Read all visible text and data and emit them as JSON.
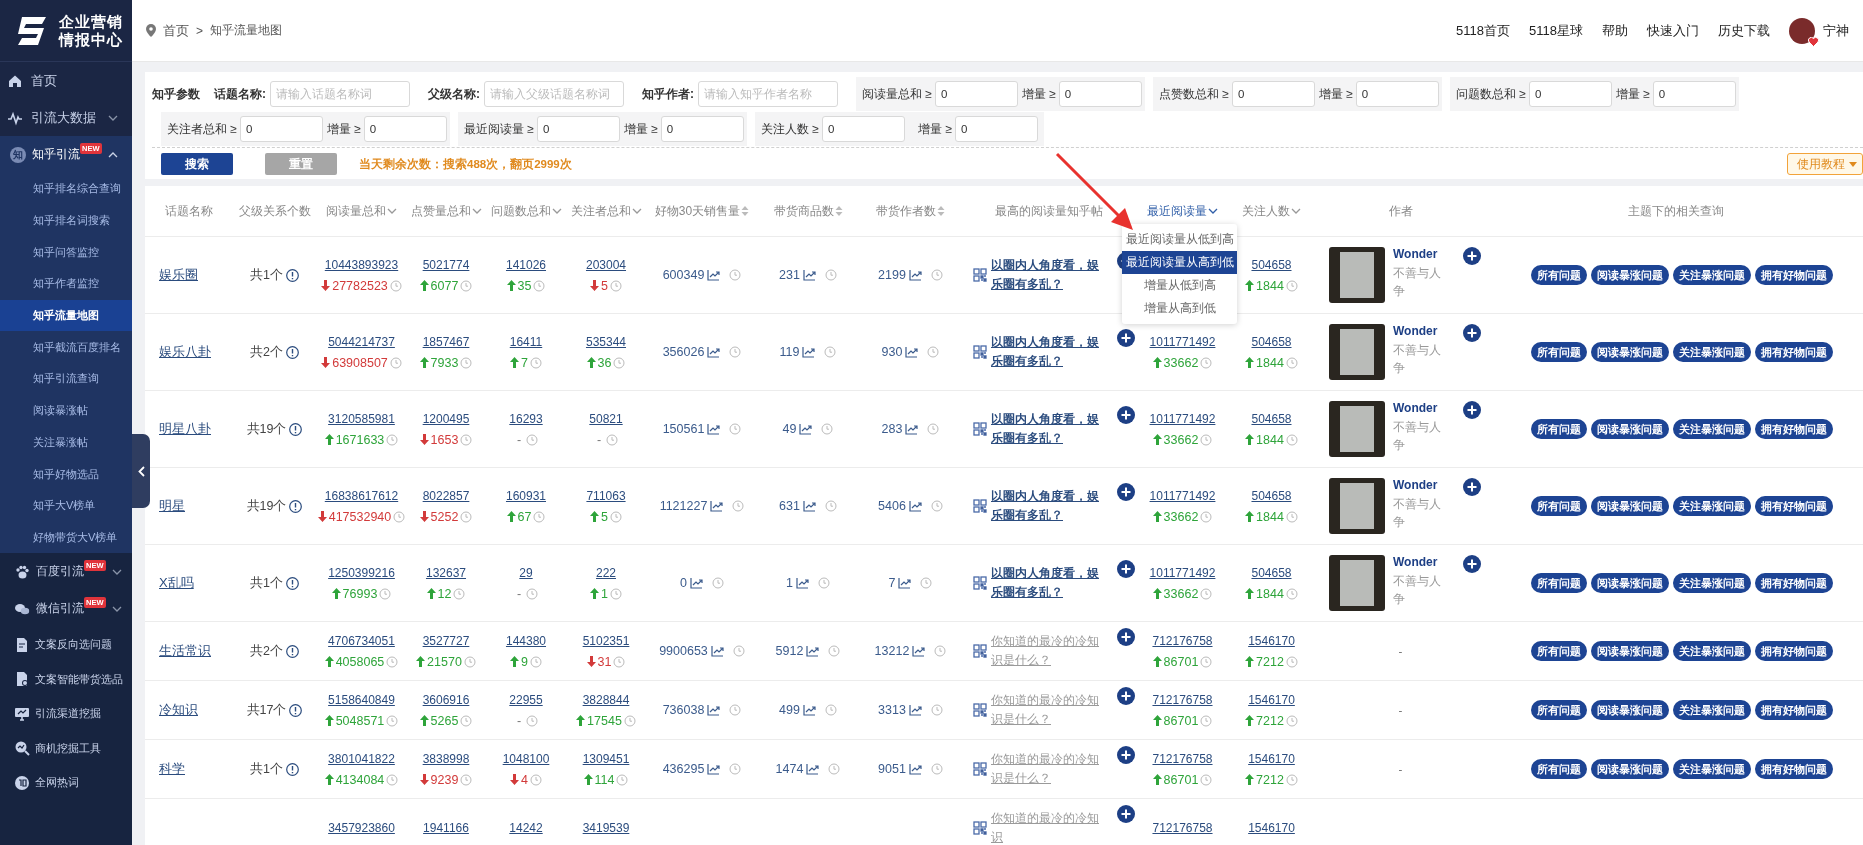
{
  "sidebar": {
    "logo_lines": [
      "企业营销",
      "情报中心"
    ],
    "items": [
      {
        "label": "首页",
        "kind": "nav"
      },
      {
        "label": "引流大数据",
        "kind": "group",
        "expanded": false
      },
      {
        "label": "知乎引流",
        "kind": "group",
        "icon_text": "知",
        "badge": "NEW",
        "expanded": true,
        "children": [
          {
            "label": "知乎排名综合查询",
            "selected": false
          },
          {
            "label": "知乎排名词搜索",
            "selected": false
          },
          {
            "label": "知乎问答监控",
            "selected": false
          },
          {
            "label": "知乎作者监控",
            "selected": false
          },
          {
            "label": "知乎流量地图",
            "selected": true
          },
          {
            "label": "知乎截流百度排名",
            "selected": false
          },
          {
            "label": "知乎引流查询",
            "selected": false
          },
          {
            "label": "阅读暴涨帖",
            "selected": false
          },
          {
            "label": "关注暴涨帖",
            "selected": false
          },
          {
            "label": "知乎好物选品",
            "selected": false
          },
          {
            "label": "知乎大V榜单",
            "selected": false
          },
          {
            "label": "好物带货大V榜单",
            "selected": false
          }
        ]
      },
      {
        "label": "百度引流",
        "kind": "group",
        "badge": "NEW",
        "expanded": false
      },
      {
        "label": "微信引流",
        "kind": "group",
        "badge": "NEW",
        "expanded": false
      },
      {
        "label": "文案反向选问题",
        "kind": "tool"
      },
      {
        "label": "文案智能带货选品",
        "kind": "tool"
      },
      {
        "label": "引流渠道挖掘",
        "kind": "tool"
      },
      {
        "label": "商机挖掘工具",
        "kind": "tool"
      },
      {
        "label": "全网热词",
        "kind": "tool"
      }
    ]
  },
  "header": {
    "breadcrumb": [
      "首页",
      "知乎流量地图"
    ],
    "breadcrumb_separator": ">",
    "nav_links": [
      "5118首页",
      "5118星球",
      "帮助",
      "快速入门",
      "历史下载"
    ],
    "user": {
      "name": "宁神"
    }
  },
  "filters": {
    "rows": [
      {
        "label": "知乎参数",
        "text_fields": [
          {
            "label": "话题名称:",
            "placeholder": "请输入话题名称词"
          },
          {
            "label": "父级名称:",
            "placeholder": "请输入父级话题名称词"
          },
          {
            "label": "知乎作者:",
            "placeholder": "请输入知乎作者名称"
          }
        ],
        "range_groups": [
          {
            "fields": [
              {
                "label": "阅读量总和 ≥",
                "value": "0"
              },
              {
                "label": "增量 ≥",
                "value": "0"
              }
            ]
          },
          {
            "fields": [
              {
                "label": "点赞数总和 ≥",
                "value": "0"
              },
              {
                "label": "增量 ≥",
                "value": "0"
              }
            ]
          },
          {
            "fields": [
              {
                "label": "问题数总和 ≥",
                "value": "0"
              },
              {
                "label": "增量 ≥",
                "value": "0"
              }
            ]
          }
        ]
      },
      {
        "range_groups": [
          {
            "fields": [
              {
                "label": "关注者总和 ≥",
                "value": "0"
              },
              {
                "label": "增量 ≥",
                "value": "0"
              }
            ]
          },
          {
            "fields": [
              {
                "label": "最近阅读量 ≥",
                "value": "0"
              },
              {
                "label": "增量 ≥",
                "value": "0"
              }
            ]
          },
          {
            "fields": [
              {
                "label": "关注人数 ≥",
                "value": "0"
              },
              {
                "label": "增量 ≥",
                "value": "0"
              }
            ]
          }
        ]
      }
    ],
    "search_button": "搜索",
    "reset_button": "重置",
    "quota_text": "当天剩余次数：搜索488次，翻页2999次",
    "tutorial_button": "使用教程"
  },
  "table": {
    "columns": [
      {
        "label": "话题名称",
        "kind": "plain",
        "selected": false
      },
      {
        "label": "父级关系个数",
        "kind": "plain",
        "selected": false
      },
      {
        "label": "阅读量总和",
        "kind": "desc",
        "selected": false
      },
      {
        "label": "点赞量总和",
        "kind": "desc",
        "selected": false
      },
      {
        "label": "问题数总和",
        "kind": "desc",
        "selected": false
      },
      {
        "label": "关注者总和",
        "kind": "desc",
        "selected": false
      },
      {
        "label": "好物30天销售量",
        "kind": "both",
        "selected": false
      },
      {
        "label": "带货商品数",
        "kind": "both",
        "selected": false
      },
      {
        "label": "带货作者数",
        "kind": "both",
        "selected": false
      },
      {
        "label": "最高的阅读量知乎帖",
        "kind": "plain",
        "selected": false
      },
      {
        "label": "最近阅读量",
        "kind": "desc",
        "selected": true,
        "menu": [
          {
            "label": "最近阅读量从低到高",
            "selected": false
          },
          {
            "label": "最近阅读量从高到低",
            "selected": true
          },
          {
            "label": "增量从低到高",
            "selected": false
          },
          {
            "label": "增量从高到低",
            "selected": false
          }
        ]
      },
      {
        "label": "关注人数",
        "kind": "desc",
        "selected": false
      },
      {
        "label": "作者",
        "kind": "plain",
        "selected": false
      },
      {
        "label": "主题下的相关查询",
        "kind": "plain",
        "selected": false
      }
    ],
    "rows": [
      {
        "topic": "娱乐圈",
        "parent_count": "共1个",
        "read": {
          "value": "10443893923",
          "delta": {
            "kind": "down",
            "value": "27782523"
          }
        },
        "likes": {
          "value": "5021774",
          "delta": {
            "kind": "up",
            "value": "6077"
          }
        },
        "questions": {
          "value": "141026",
          "delta": {
            "kind": "up",
            "value": "35"
          }
        },
        "followers": {
          "value": "203004",
          "delta": {
            "kind": "down",
            "value": "5"
          }
        },
        "sales": "600349",
        "goods": "231",
        "sellers": "2199",
        "post": {
          "title": "以圈内人角度看，娱乐圈有多乱？",
          "visited": false
        },
        "fans": {
          "value": "504658",
          "delta": {
            "kind": "up",
            "value": "1844"
          }
        },
        "author": {
          "kind": "profile",
          "name": "Wonder",
          "bio": "不善与人争"
        },
        "actions": [
          "所有问题",
          "阅读暴涨问题",
          "关注暴涨问题",
          "拥有好物问题"
        ]
      },
      {
        "topic": "娱乐八卦",
        "parent_count": "共2个",
        "read": {
          "value": "5044214737",
          "delta": {
            "kind": "down",
            "value": "63908507"
          }
        },
        "likes": {
          "value": "1857467",
          "delta": {
            "kind": "up",
            "value": "7933"
          }
        },
        "questions": {
          "value": "16411",
          "delta": {
            "kind": "up",
            "value": "7"
          }
        },
        "followers": {
          "value": "535344",
          "delta": {
            "kind": "up",
            "value": "36"
          }
        },
        "sales": "356026",
        "goods": "119",
        "sellers": "930",
        "post": {
          "title": "以圈内人角度看，娱乐圈有多乱？",
          "visited": false
        },
        "recent": {
          "value": "1011771492",
          "delta": {
            "kind": "up",
            "value": "33662"
          }
        },
        "fans": {
          "value": "504658",
          "delta": {
            "kind": "up",
            "value": "1844"
          }
        },
        "author": {
          "kind": "profile",
          "name": "Wonder",
          "bio": "不善与人争"
        },
        "actions": [
          "所有问题",
          "阅读暴涨问题",
          "关注暴涨问题",
          "拥有好物问题"
        ]
      },
      {
        "topic": "明星八卦",
        "parent_count": "共19个",
        "read": {
          "value": "3120585981",
          "delta": {
            "kind": "up",
            "value": "1671633"
          }
        },
        "likes": {
          "value": "1200495",
          "delta": {
            "kind": "down",
            "value": "1653"
          }
        },
        "questions": {
          "value": "16293",
          "delta": {
            "kind": "none",
            "value": "-"
          }
        },
        "followers": {
          "value": "50821",
          "delta": {
            "kind": "none",
            "value": "-"
          }
        },
        "sales": "150561",
        "goods": "49",
        "sellers": "283",
        "post": {
          "title": "以圈内人角度看，娱乐圈有多乱？",
          "visited": false
        },
        "recent": {
          "value": "1011771492",
          "delta": {
            "kind": "up",
            "value": "33662"
          }
        },
        "fans": {
          "value": "504658",
          "delta": {
            "kind": "up",
            "value": "1844"
          }
        },
        "author": {
          "kind": "profile",
          "name": "Wonder",
          "bio": "不善与人争"
        },
        "actions": [
          "所有问题",
          "阅读暴涨问题",
          "关注暴涨问题",
          "拥有好物问题"
        ]
      },
      {
        "topic": "明星",
        "parent_count": "共19个",
        "read": {
          "value": "16838617612",
          "delta": {
            "kind": "down",
            "value": "417532940"
          }
        },
        "likes": {
          "value": "8022857",
          "delta": {
            "kind": "down",
            "value": "5252"
          }
        },
        "questions": {
          "value": "160931",
          "delta": {
            "kind": "up",
            "value": "67"
          }
        },
        "followers": {
          "value": "711063",
          "delta": {
            "kind": "up",
            "value": "5"
          }
        },
        "sales": "1121227",
        "goods": "631",
        "sellers": "5406",
        "post": {
          "title": "以圈内人角度看，娱乐圈有多乱？",
          "visited": false
        },
        "recent": {
          "value": "1011771492",
          "delta": {
            "kind": "up",
            "value": "33662"
          }
        },
        "fans": {
          "value": "504658",
          "delta": {
            "kind": "up",
            "value": "1844"
          }
        },
        "author": {
          "kind": "profile",
          "name": "Wonder",
          "bio": "不善与人争"
        },
        "actions": [
          "所有问题",
          "阅读暴涨问题",
          "关注暴涨问题",
          "拥有好物问题"
        ]
      },
      {
        "topic": "X乱吗",
        "parent_count": "共1个",
        "read": {
          "value": "1250399216",
          "delta": {
            "kind": "up",
            "value": "76993"
          }
        },
        "likes": {
          "value": "132637",
          "delta": {
            "kind": "up",
            "value": "12"
          }
        },
        "questions": {
          "value": "29",
          "delta": {
            "kind": "none",
            "value": "-"
          }
        },
        "followers": {
          "value": "222",
          "delta": {
            "kind": "up",
            "value": "1"
          }
        },
        "sales": "0",
        "goods": "1",
        "sellers": "7",
        "post": {
          "title": "以圈内人角度看，娱乐圈有多乱？",
          "visited": false
        },
        "recent": {
          "value": "1011771492",
          "delta": {
            "kind": "up",
            "value": "33662"
          }
        },
        "fans": {
          "value": "504658",
          "delta": {
            "kind": "up",
            "value": "1844"
          }
        },
        "author": {
          "kind": "profile",
          "name": "Wonder",
          "bio": "不善与人争"
        },
        "actions": [
          "所有问题",
          "阅读暴涨问题",
          "关注暴涨问题",
          "拥有好物问题"
        ]
      },
      {
        "topic": "生活常识",
        "parent_count": "共2个",
        "read": {
          "value": "4706734051",
          "delta": {
            "kind": "up",
            "value": "4058065"
          }
        },
        "likes": {
          "value": "3527727",
          "delta": {
            "kind": "up",
            "value": "21570"
          }
        },
        "questions": {
          "value": "144380",
          "delta": {
            "kind": "up",
            "value": "9"
          }
        },
        "followers": {
          "value": "5102351",
          "delta": {
            "kind": "down",
            "value": "31"
          }
        },
        "sales": "9900653",
        "goods": "5912",
        "sellers": "13212",
        "post": {
          "title": "你知道的最冷的冷知识是什么？",
          "visited": true
        },
        "recent": {
          "value": "712176758",
          "delta": {
            "kind": "up",
            "value": "86701"
          }
        },
        "fans": {
          "value": "1546170",
          "delta": {
            "kind": "up",
            "value": "7212"
          }
        },
        "author": {
          "kind": "none",
          "text": "-"
        },
        "actions": [
          "所有问题",
          "阅读暴涨问题",
          "关注暴涨问题",
          "拥有好物问题"
        ]
      },
      {
        "topic": "冷知识",
        "parent_count": "共17个",
        "read": {
          "value": "5158640849",
          "delta": {
            "kind": "up",
            "value": "5048571"
          }
        },
        "likes": {
          "value": "3606916",
          "delta": {
            "kind": "up",
            "value": "5265"
          }
        },
        "questions": {
          "value": "22955",
          "delta": {
            "kind": "none",
            "value": "-"
          }
        },
        "followers": {
          "value": "3828844",
          "delta": {
            "kind": "up",
            "value": "17545"
          }
        },
        "sales": "736038",
        "goods": "499",
        "sellers": "3313",
        "post": {
          "title": "你知道的最冷的冷知识是什么？",
          "visited": true
        },
        "recent": {
          "value": "712176758",
          "delta": {
            "kind": "up",
            "value": "86701"
          }
        },
        "fans": {
          "value": "1546170",
          "delta": {
            "kind": "up",
            "value": "7212"
          }
        },
        "author": {
          "kind": "none",
          "text": "-"
        },
        "actions": [
          "所有问题",
          "阅读暴涨问题",
          "关注暴涨问题",
          "拥有好物问题"
        ]
      },
      {
        "topic": "科学",
        "parent_count": "共1个",
        "read": {
          "value": "3801041822",
          "delta": {
            "kind": "up",
            "value": "4134084"
          }
        },
        "likes": {
          "value": "3838998",
          "delta": {
            "kind": "down",
            "value": "9239"
          }
        },
        "questions": {
          "value": "1048100",
          "delta": {
            "kind": "down",
            "value": "4"
          }
        },
        "followers": {
          "value": "1309451",
          "delta": {
            "kind": "up",
            "value": "114"
          }
        },
        "sales": "436295",
        "goods": "1474",
        "sellers": "9051",
        "post": {
          "title": "你知道的最冷的冷知识是什么？",
          "visited": true
        },
        "recent": {
          "value": "712176758",
          "delta": {
            "kind": "up",
            "value": "86701"
          }
        },
        "fans": {
          "value": "1546170",
          "delta": {
            "kind": "up",
            "value": "7212"
          }
        },
        "author": {
          "kind": "none",
          "text": "-"
        },
        "actions": [
          "所有问题",
          "阅读暴涨问题",
          "关注暴涨问题",
          "拥有好物问题"
        ]
      },
      {
        "read": {
          "value": "3457923860"
        },
        "likes": {
          "value": "1941166"
        },
        "questions": {
          "value": "14242"
        },
        "followers": {
          "value": "3419539"
        },
        "post": {
          "title": "你知道的最冷的冷知识",
          "visited": true
        },
        "recent": {
          "value": "712176758"
        },
        "fans": {
          "value": "1546170"
        }
      }
    ]
  }
}
